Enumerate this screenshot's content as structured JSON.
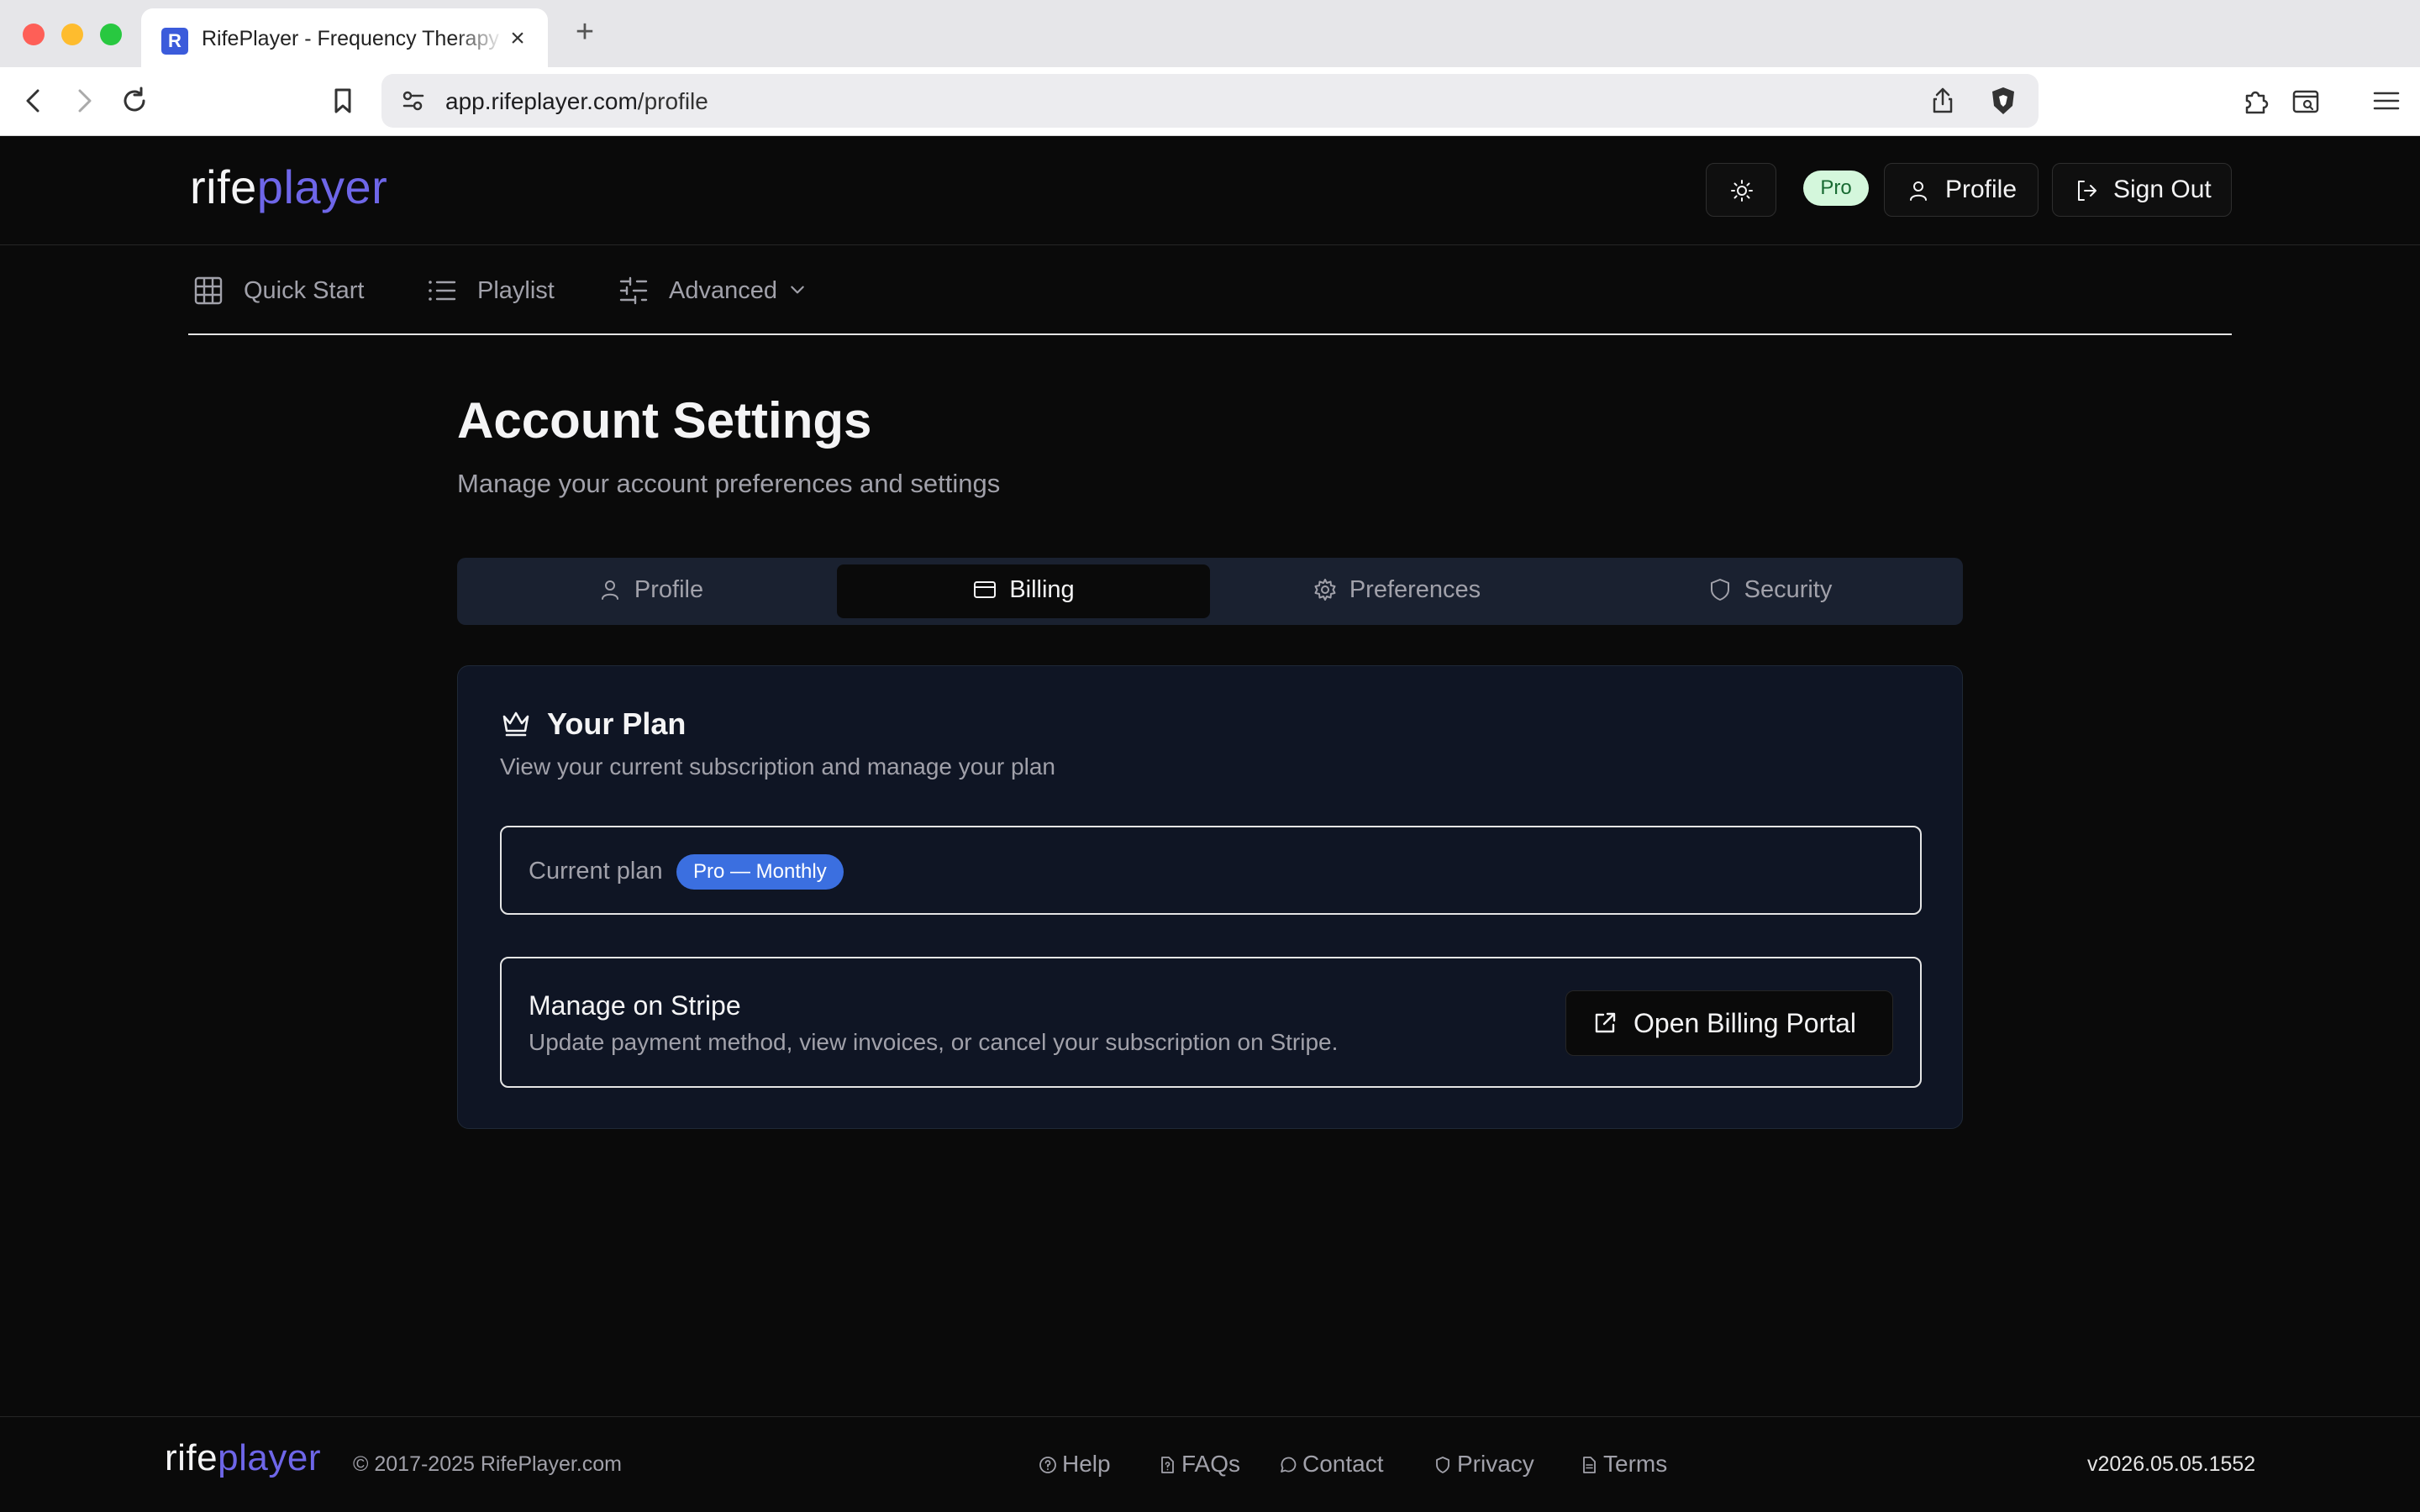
{
  "browser": {
    "tab_title": "RifePlayer - Frequency Therapy",
    "favicon_letter": "R",
    "url_host": "app.rifeplayer.com",
    "url_path": "/profile"
  },
  "header": {
    "logo_part1": "rife",
    "logo_part2": "player",
    "pro_badge": "Pro",
    "profile_label": "Profile",
    "signout_label": "Sign Out"
  },
  "nav": {
    "items": [
      {
        "label": "Quick Start",
        "icon": "grid-icon"
      },
      {
        "label": "Playlist",
        "icon": "list-icon"
      },
      {
        "label": "Advanced",
        "icon": "sliders-icon"
      }
    ]
  },
  "page": {
    "title": "Account Settings",
    "subtitle": "Manage your account preferences and settings"
  },
  "tabs": [
    {
      "label": "Profile",
      "icon": "user-icon"
    },
    {
      "label": "Billing",
      "icon": "credit-card-icon",
      "active": true
    },
    {
      "label": "Preferences",
      "icon": "gear-icon"
    },
    {
      "label": "Security",
      "icon": "shield-icon"
    }
  ],
  "plan_card": {
    "title": "Your Plan",
    "subtitle": "View your current subscription and manage your plan",
    "current_plan_label": "Current plan",
    "current_plan_value": "Pro — Monthly",
    "stripe_title": "Manage on Stripe",
    "stripe_desc": "Update payment method, view invoices, or cancel your subscription on Stripe.",
    "portal_button": "Open Billing Portal"
  },
  "footer": {
    "copyright": "© 2017-2025 RifePlayer.com",
    "links": [
      "Help",
      "FAQs",
      "Contact",
      "Privacy",
      "Terms"
    ],
    "version": "v2026.05.05.1552"
  },
  "colors": {
    "background": "#0a0a0a",
    "accent": "#6e66e8",
    "plan_badge": "#3b6fe0",
    "pro_badge_bg": "#d4f7dc"
  }
}
